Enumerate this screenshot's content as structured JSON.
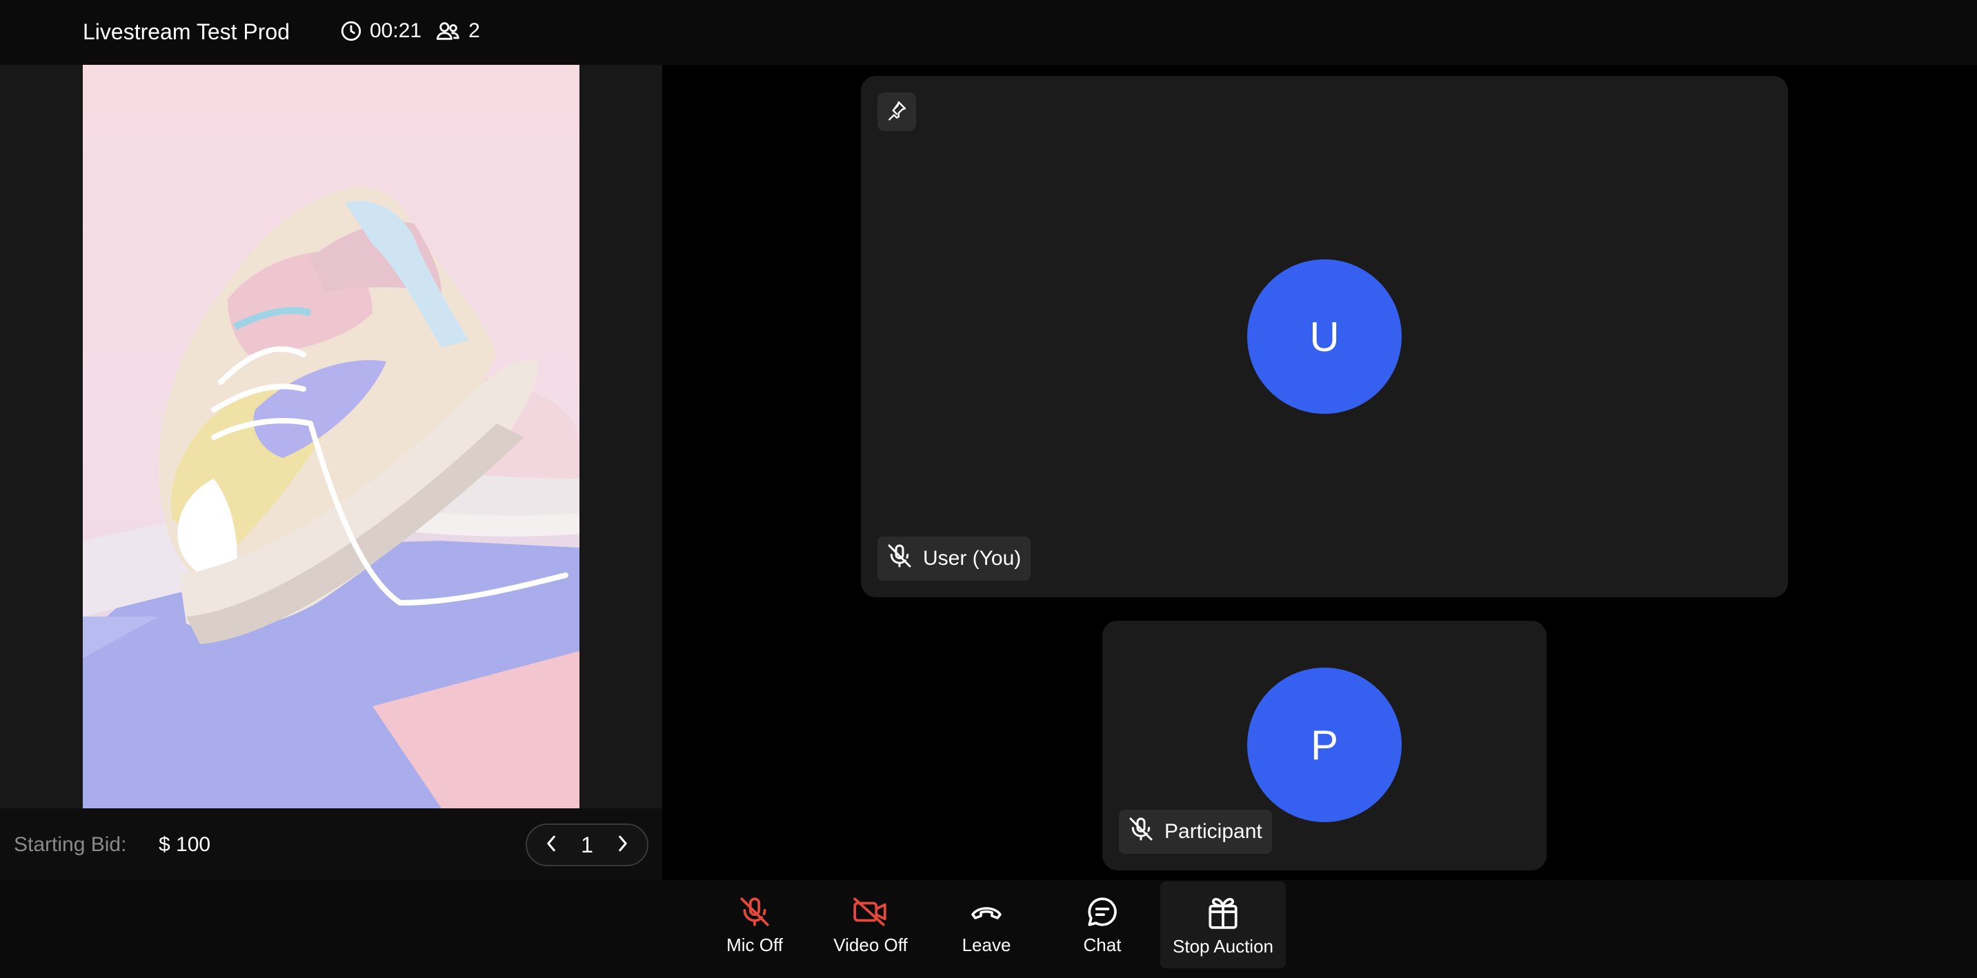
{
  "header": {
    "title": "Livestream Test Prod",
    "elapsed": "00:21",
    "participant_count": "2"
  },
  "product": {
    "image_icon": "sneaker-product-photo",
    "bid_label": "Starting Bid:",
    "bid_value": "$ 100",
    "page_number": "1"
  },
  "tiles": {
    "main": {
      "initial": "U",
      "name": "User (You)",
      "mic_icon": "mic-off-icon",
      "pin_icon": "pin-icon"
    },
    "secondary": {
      "initial": "P",
      "name": "Participant",
      "mic_icon": "mic-off-icon"
    }
  },
  "controls": [
    {
      "label": "Mic Off",
      "icon": "mic-off-icon",
      "color": "#e5483c"
    },
    {
      "label": "Video Off",
      "icon": "video-off-icon",
      "color": "#e5483c"
    },
    {
      "label": "Leave",
      "icon": "phone-hangup-icon",
      "color": "#ffffff"
    },
    {
      "label": "Chat",
      "icon": "chat-icon",
      "color": "#ffffff"
    },
    {
      "label": "Stop Auction",
      "icon": "gift-icon",
      "color": "#ffffff"
    }
  ],
  "colors": {
    "avatar": "#3560f0",
    "danger": "#e5483c",
    "tile_bg": "#1b1b1b"
  }
}
